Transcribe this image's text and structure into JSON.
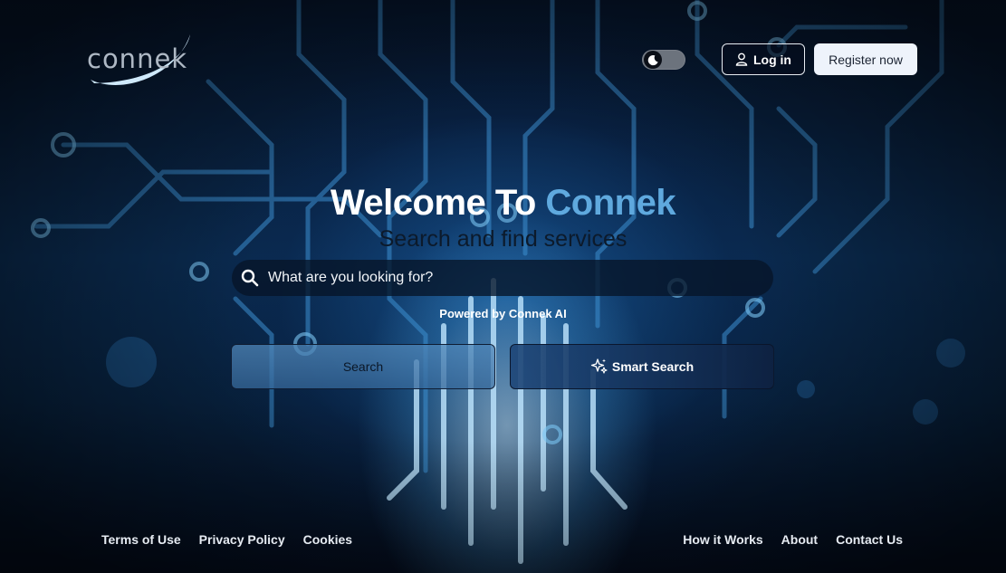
{
  "header": {
    "logo_text": "connek",
    "login_label": "Log in",
    "register_label": "Register now"
  },
  "hero": {
    "title_prefix": "Welcome To ",
    "title_accent": "Connek",
    "subtitle": "Search and find services",
    "search_placeholder": "What are you looking for?",
    "powered_by": "Powered by Connek AI",
    "search_button": "Search",
    "smart_search_button": "Smart Search"
  },
  "footer": {
    "left_links": [
      "Terms of Use",
      "Privacy Policy",
      "Cookies"
    ],
    "right_links": [
      "How it Works",
      "About",
      "Contact Us"
    ]
  },
  "theme": {
    "accent": "#5fa9de",
    "background": "#06142a"
  },
  "icons": {
    "theme_toggle": "moon-icon",
    "login": "user-icon",
    "search": "search-icon",
    "smart_search": "sparkles-icon"
  }
}
